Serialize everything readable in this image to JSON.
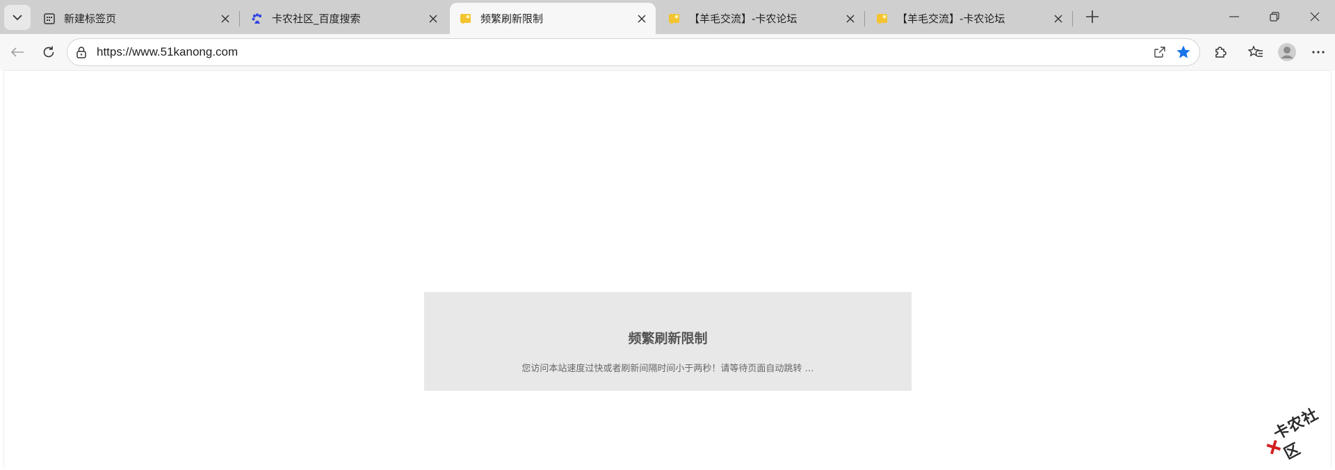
{
  "tabs": [
    {
      "title": "新建标签页",
      "icon": "new-tab-page-icon",
      "active": false
    },
    {
      "title": "卡农社区_百度搜索",
      "icon": "baidu-paw-icon",
      "active": false
    },
    {
      "title": "频繁刷新限制",
      "icon": "site-favicon-icon",
      "active": true
    },
    {
      "title": "【羊毛交流】-卡农论坛",
      "icon": "site-favicon-icon",
      "active": false
    },
    {
      "title": "【羊毛交流】-卡农论坛",
      "icon": "site-favicon-icon",
      "active": false
    }
  ],
  "address_bar": {
    "url": "https://www.51kanong.com"
  },
  "page": {
    "heading": "频繁刷新限制",
    "message": "您访问本站速度过快或者刷新间隔时间小于两秒！请等待页面自动跳转 …"
  },
  "watermark": {
    "text": "卡农社区"
  },
  "colors": {
    "accent_star": "#1a73e8",
    "notice_bg": "#e8e8e8",
    "tabstrip_bg": "#cfcfcf"
  }
}
